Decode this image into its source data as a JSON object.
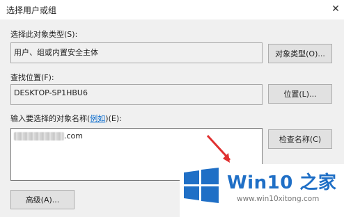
{
  "window": {
    "title": "选择用户或组"
  },
  "object_type": {
    "label": "选择此对象类型(S):",
    "value": "用户、组或内置安全主体",
    "button": "对象类型(O)..."
  },
  "location": {
    "label": "查找位置(F):",
    "value": "DESKTOP-SP1HBU6",
    "button": "位置(L)..."
  },
  "names": {
    "label_prefix": "输入要选择的对象名称(",
    "label_link": "例如",
    "label_suffix": ")(E):",
    "value_suffix": ".com",
    "check_button": "检查名称(C)"
  },
  "advanced_button": "高级(A)...",
  "watermark": {
    "title": "Win10 之家",
    "url": "www.win10xitong.com",
    "brand_color": "#1f6fc6"
  },
  "accent": {
    "arrow": "#e03030"
  }
}
